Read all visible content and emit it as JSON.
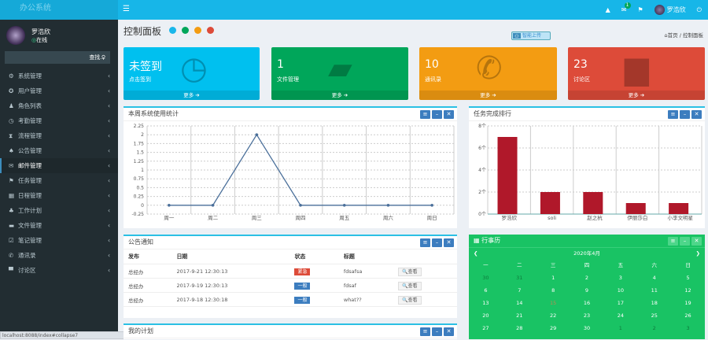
{
  "app": {
    "title": "办公系统",
    "status_url": "localhost:8088/index#collapse7"
  },
  "header": {
    "mail_badge": "1",
    "user": "罗浩欣"
  },
  "sidebar": {
    "user": "罗浩欣",
    "online": "在线",
    "search_placeholder": "查找...",
    "items": [
      {
        "icon": "gear",
        "label": "系统管理"
      },
      {
        "icon": "users",
        "label": "用户管理"
      },
      {
        "icon": "user",
        "label": "角色列表"
      },
      {
        "icon": "clock",
        "label": "考勤管理"
      },
      {
        "icon": "hourglass",
        "label": "流程管理"
      },
      {
        "icon": "bell",
        "label": "公告管理"
      },
      {
        "icon": "envelope",
        "label": "邮件管理"
      },
      {
        "icon": "flag",
        "label": "任务管理"
      },
      {
        "icon": "calendar",
        "label": "日程管理"
      },
      {
        "icon": "tree",
        "label": "工作计划"
      },
      {
        "icon": "folder",
        "label": "文件管理"
      },
      {
        "icon": "edit",
        "label": "笔记管理"
      },
      {
        "icon": "phone",
        "label": "通讯录"
      },
      {
        "icon": "comment",
        "label": "讨论区"
      }
    ]
  },
  "page": {
    "title": "控制面板",
    "upload": "智能上传",
    "breadcrumb": [
      "首页",
      "控制面板"
    ],
    "theme_colors": [
      "#1ab7ea",
      "#00a65a",
      "#f39c12",
      "#dd4b39"
    ]
  },
  "cards": [
    {
      "value": "未签到",
      "label": "点击签到",
      "more": "更多",
      "color": "#00c0ef",
      "icon": "clock"
    },
    {
      "value": "1",
      "label": "文件管理",
      "more": "更多",
      "color": "#00a65a",
      "icon": "folder"
    },
    {
      "value": "10",
      "label": "通讯录",
      "more": "更多",
      "color": "#f39c12",
      "icon": "phone"
    },
    {
      "value": "23",
      "label": "讨论区",
      "more": "更多",
      "color": "#dd4b39",
      "icon": "comment"
    }
  ],
  "chart_data": [
    {
      "type": "line",
      "title": "本周系统使用统计",
      "categories": [
        "周一",
        "周二",
        "周三",
        "周四",
        "周五",
        "周六",
        "周日"
      ],
      "values": [
        0,
        0,
        2,
        0,
        0,
        0,
        0
      ],
      "ylim": [
        -0.25,
        2.25
      ],
      "yticks": [
        "2.25",
        "2",
        "1.75",
        "1.5",
        "1.25",
        "1",
        "0.75",
        "0.5",
        "0.25",
        "0",
        "-0.25"
      ],
      "color": "#4a6f9a"
    },
    {
      "type": "bar",
      "title": "任务完成排行",
      "categories": [
        "罗浩欣",
        "soli",
        "赵之杭",
        "伊丽莎白",
        "小李文明星"
      ],
      "values": [
        7,
        2,
        2,
        1,
        1
      ],
      "ylim": [
        0,
        8
      ],
      "yticks": [
        "8个",
        "6个",
        "4个",
        "2个",
        "0个"
      ],
      "color": "#b0182a"
    }
  ],
  "notice": {
    "title": "公告通知",
    "headers": [
      "发布",
      "日期",
      "状态",
      "标题"
    ],
    "view": "查看",
    "rows": [
      {
        "from": "总经办",
        "date": "2017-9-21 12:30:13",
        "status": "紧急",
        "status_color": "#dd4b39",
        "title": "fdsafsa"
      },
      {
        "from": "总经办",
        "date": "2017-9-19 12:30:13",
        "status": "一般",
        "status_color": "#3c7dbf",
        "title": "fdsaf"
      },
      {
        "from": "总经办",
        "date": "2017-9-18 12:30:18",
        "status": "一般",
        "status_color": "#3c7dbf",
        "title": "what??"
      }
    ]
  },
  "plan": {
    "title": "我的计划"
  },
  "calendar": {
    "title": "行事历",
    "month": "2020年4月",
    "weekdays": [
      "一",
      "二",
      "三",
      "四",
      "五",
      "六",
      "日"
    ],
    "days": [
      [
        "30",
        "31",
        "1",
        "2",
        "3",
        "4",
        "5"
      ],
      [
        "6",
        "7",
        "8",
        "9",
        "10",
        "11",
        "12"
      ],
      [
        "13",
        "14",
        "15",
        "16",
        "17",
        "18",
        "19"
      ],
      [
        "20",
        "21",
        "22",
        "23",
        "24",
        "25",
        "26"
      ],
      [
        "27",
        "28",
        "29",
        "30",
        "1",
        "2",
        "3"
      ]
    ]
  }
}
